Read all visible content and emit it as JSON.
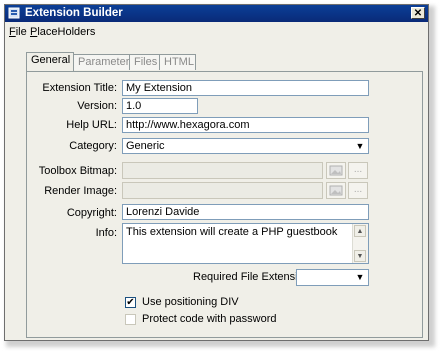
{
  "window": {
    "title": "Extension Builder",
    "close_glyph": "✕"
  },
  "menu": [
    {
      "mnemonic": "F",
      "rest": "ile"
    },
    {
      "mnemonic": "P",
      "rest": "laceHolders"
    }
  ],
  "tabs": [
    "General",
    "Parameters",
    "Files",
    "HTML"
  ],
  "form": {
    "extension_title_label": "Extension Title:",
    "extension_title_value": "My Extension",
    "version_label": "Version:",
    "version_value": "1.0",
    "help_url_label": "Help URL:",
    "help_url_value": "http://www.hexagora.com",
    "category_label": "Category:",
    "category_value": "Generic",
    "toolbox_bitmap_label": "Toolbox Bitmap:",
    "render_image_label": "Render Image:",
    "copyright_label": "Copyright:",
    "copyright_value": "Lorenzi Davide",
    "info_label": "Info:",
    "info_value": "This extension will create a PHP guestbook",
    "required_ext_label": "Required File Extension:",
    "required_ext_value": "",
    "use_div_label": "Use positioning DIV",
    "use_div_checked": true,
    "protect_label": "Protect code with password",
    "protect_checked": false,
    "browse_glyph": "...",
    "dropdown_glyph": "▼",
    "check_glyph": "✔",
    "scroll_up_glyph": "▲",
    "scroll_down_glyph": "▼"
  },
  "colors": {
    "titlebar": "#0a2a78",
    "window_bg": "#f0efe8",
    "field_border": "#7f9db9"
  }
}
